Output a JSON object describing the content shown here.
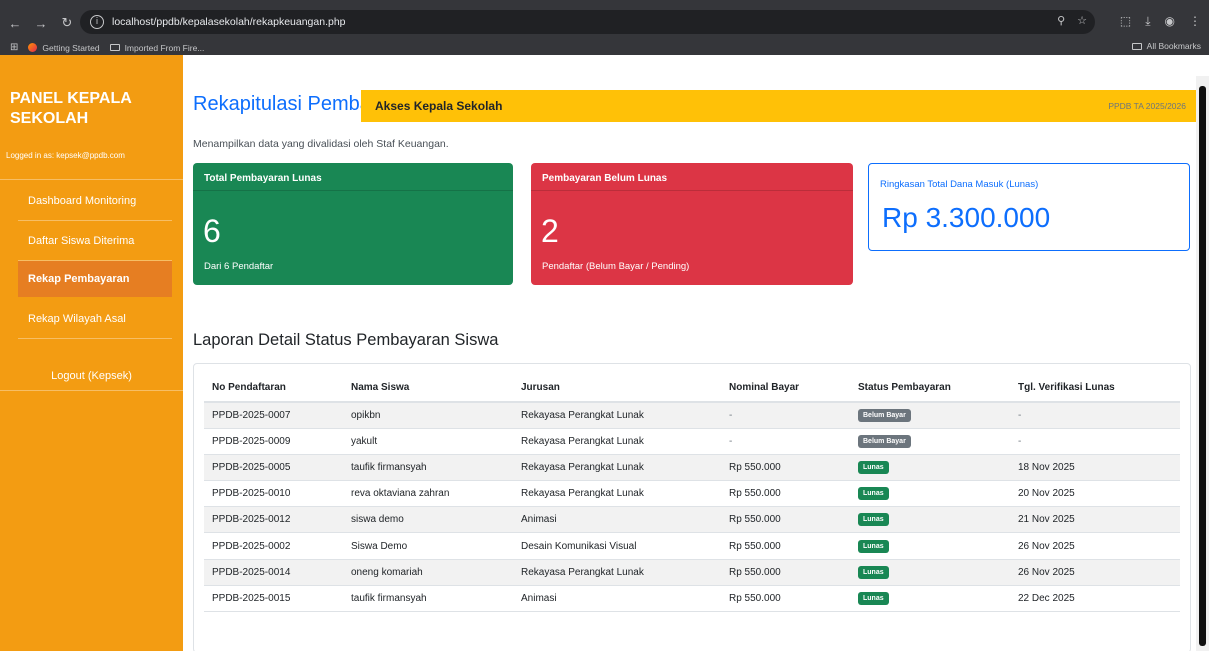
{
  "browser": {
    "url": "localhost/ppdb/kepalasekolah/rekapkeuangan.php",
    "bookmarks": [
      "Getting Started",
      "Imported From Fire..."
    ],
    "all_bookmarks": "All Bookmarks"
  },
  "sidebar": {
    "brand": "PANEL KEPALA SEKOLAH",
    "user": "Logged in as: kepsek@ppdb.com",
    "items": [
      {
        "label": "Dashboard Monitoring"
      },
      {
        "label": "Daftar Siswa Diterima"
      },
      {
        "label": "Rekap Pembayaran"
      },
      {
        "label": "Rekap Wilayah Asal"
      }
    ],
    "logout": "Logout (Kepsek)"
  },
  "topbar": {
    "title": "Akses Kepala Sekolah",
    "right": "PPDB TA 2025/2026"
  },
  "main": {
    "title": "Rekapitulasi Pembayaran",
    "subtitle": "Menampilkan data yang divalidasi oleh Staf Keuangan.",
    "cards": {
      "lunas": {
        "title": "Total Pembayaran Lunas",
        "value": "6",
        "footer": "Dari 6 Pendaftar"
      },
      "belum": {
        "title": "Pembayaran Belum Lunas",
        "value": "2",
        "footer": "Pendaftar (Belum Bayar / Pending)"
      },
      "dana": {
        "title": "Ringkasan Total Dana Masuk (Lunas)",
        "value": "Rp 3.300.000"
      }
    },
    "section_title": "Laporan Detail Status Pembayaran Siswa",
    "table": {
      "headers": [
        "No Pendaftaran",
        "Nama Siswa",
        "Jurusan",
        "Nominal Bayar",
        "Status Pembayaran",
        "Tgl. Verifikasi Lunas"
      ],
      "rows": [
        [
          "PPDB-2025-0007",
          "opikbn",
          "Rekayasa Perangkat Lunak",
          "-",
          "Belum Bayar",
          "-"
        ],
        [
          "PPDB-2025-0009",
          "yakult",
          "Rekayasa Perangkat Lunak",
          "-",
          "Belum Bayar",
          "-"
        ],
        [
          "PPDB-2025-0005",
          "taufik firmansyah",
          "Rekayasa Perangkat Lunak",
          "Rp 550.000",
          "Lunas",
          "18 Nov 2025"
        ],
        [
          "PPDB-2025-0010",
          "reva oktaviana zahran",
          "Rekayasa Perangkat Lunak",
          "Rp 550.000",
          "Lunas",
          "20 Nov 2025"
        ],
        [
          "PPDB-2025-0012",
          "siswa demo",
          "Animasi",
          "Rp 550.000",
          "Lunas",
          "21 Nov 2025"
        ],
        [
          "PPDB-2025-0002",
          "Siswa Demo",
          "Desain Komunikasi Visual",
          "Rp 550.000",
          "Lunas",
          "26 Nov 2025"
        ],
        [
          "PPDB-2025-0014",
          "oneng komariah",
          "Rekayasa Perangkat Lunak",
          "Rp 550.000",
          "Lunas",
          "26 Nov 2025"
        ],
        [
          "PPDB-2025-0015",
          "taufik firmansyah",
          "Animasi",
          "Rp 550.000",
          "Lunas",
          "22 Dec 2025"
        ]
      ]
    }
  },
  "colors": {
    "sidebar": "#f39c12",
    "sidebar_active": "#e67e22",
    "topbar": "#ffc107",
    "primary": "#0d6efd",
    "success": "#198754",
    "danger": "#dc3545",
    "secondary": "#6c757d"
  }
}
